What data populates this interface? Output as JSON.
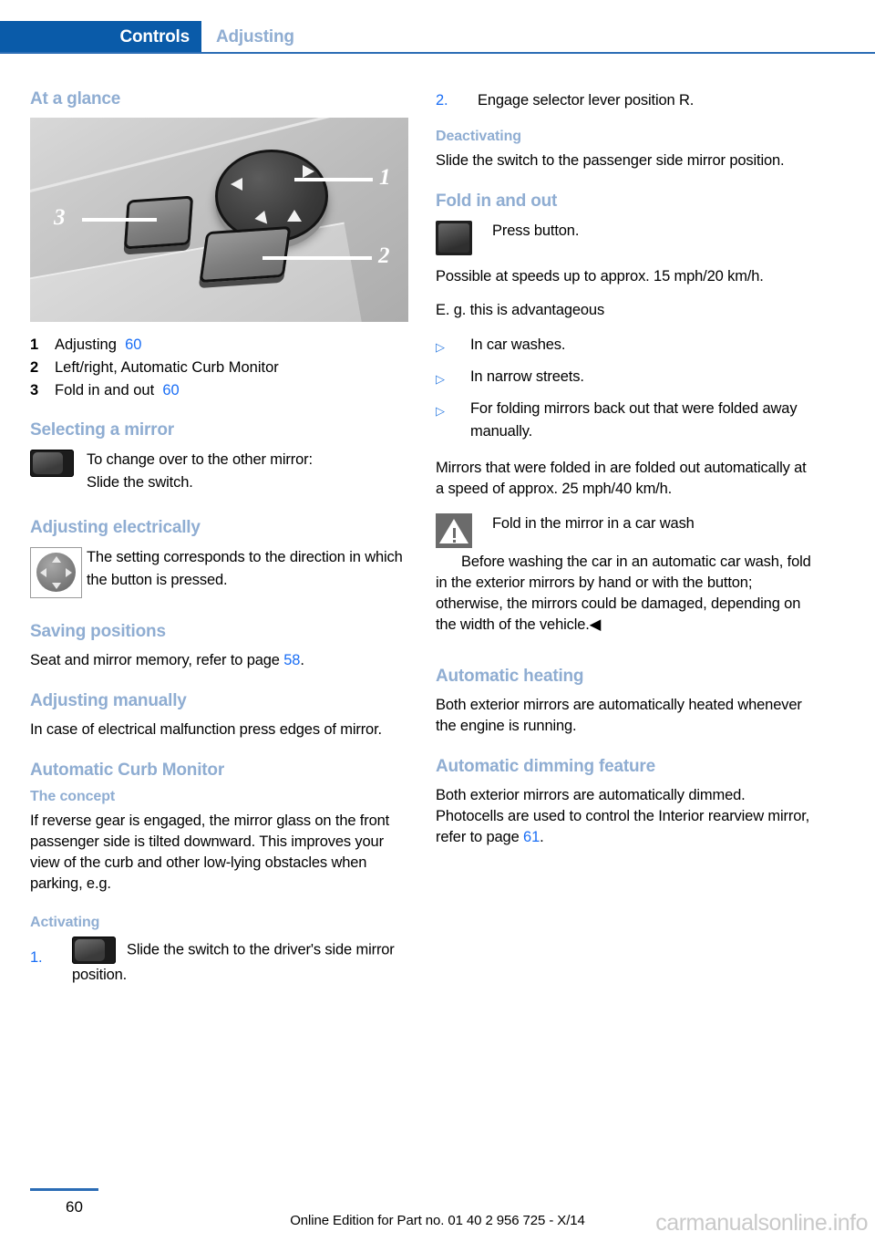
{
  "header": {
    "chapter": "Controls",
    "section": "Adjusting"
  },
  "left": {
    "at_a_glance": {
      "heading": "At a glance",
      "figure": {
        "alt": "Exterior mirror control panel on driver door",
        "callouts": [
          "1",
          "2",
          "3"
        ]
      },
      "items": [
        {
          "num": "1",
          "label": "Adjusting",
          "page": "60"
        },
        {
          "num": "2",
          "label": "Left/right, Automatic Curb Monitor",
          "page": ""
        },
        {
          "num": "3",
          "label": "Fold in and out",
          "page": "60"
        }
      ]
    },
    "selecting_a_mirror": {
      "heading": "Selecting a mirror",
      "line1": "To change over to the other mirror:",
      "line2": "Slide the switch."
    },
    "adjusting_electrically": {
      "heading": "Adjusting electrically",
      "text": "The setting corresponds to the direction in which the button is pressed."
    },
    "saving_positions": {
      "heading": "Saving positions",
      "text_before": "Seat and mirror memory, refer to page ",
      "page": "58",
      "text_after": "."
    },
    "adjusting_manually": {
      "heading": "Adjusting manually",
      "text": "In case of electrical malfunction press edges of mirror."
    },
    "automatic_curb_monitor": {
      "heading": "Automatic Curb Monitor",
      "concept_heading": "The concept",
      "concept_text": "If reverse gear is engaged, the mirror glass on the front passenger side is tilted downward. This improves your view of the curb and other low-lying obstacles when parking, e.g.",
      "activating_heading": "Activating",
      "step1_num": "1.",
      "step1_text": "Slide the switch to the driver's side mirror position."
    }
  },
  "right": {
    "activating_step2": {
      "num": "2.",
      "text": "Engage selector lever position R."
    },
    "deactivating": {
      "heading": "Deactivating",
      "text": "Slide the switch to the passenger side mirror position."
    },
    "fold_in_and_out": {
      "heading": "Fold in and out",
      "press_button": "Press button.",
      "speed_text": "Possible at speeds up to approx. 15 mph/20 km/h.",
      "eg_text": "E. g. this is advantageous",
      "bullet_mark": "▷",
      "bullets": [
        "In car washes.",
        "In narrow streets.",
        "For folding mirrors back out that were folded away manually."
      ],
      "auto_fold_text": "Mirrors that were folded in are folded out automatically at a speed of approx. 25 mph/40 km/h.",
      "warning": {
        "title": "Fold in the mirror in a car wash",
        "text": "Before washing the car in an automatic car wash, fold in the exterior mirrors by hand or with the button; otherwise, the mirrors could be damaged, depending on the width of the vehicle.◀"
      }
    },
    "automatic_heating": {
      "heading": "Automatic heating",
      "text": "Both exterior mirrors are automatically heated whenever the engine is running."
    },
    "automatic_dimming": {
      "heading": "Automatic dimming feature",
      "text_before": "Both exterior mirrors are automatically dimmed. Photocells are used to control the Interior rearview mirror, refer to page ",
      "page": "61",
      "text_after": "."
    }
  },
  "footer": {
    "page_number": "60",
    "edition_text": "Online Edition for Part no. 01 40 2 956 725 - X/14",
    "watermark": "carmanualsonline.info"
  },
  "colors": {
    "chapter_tab_bg": "#0a5ba9",
    "section_blue": "#8fadd2",
    "link_blue": "#1a6ef5",
    "rule_blue": "#2b6cb5"
  }
}
